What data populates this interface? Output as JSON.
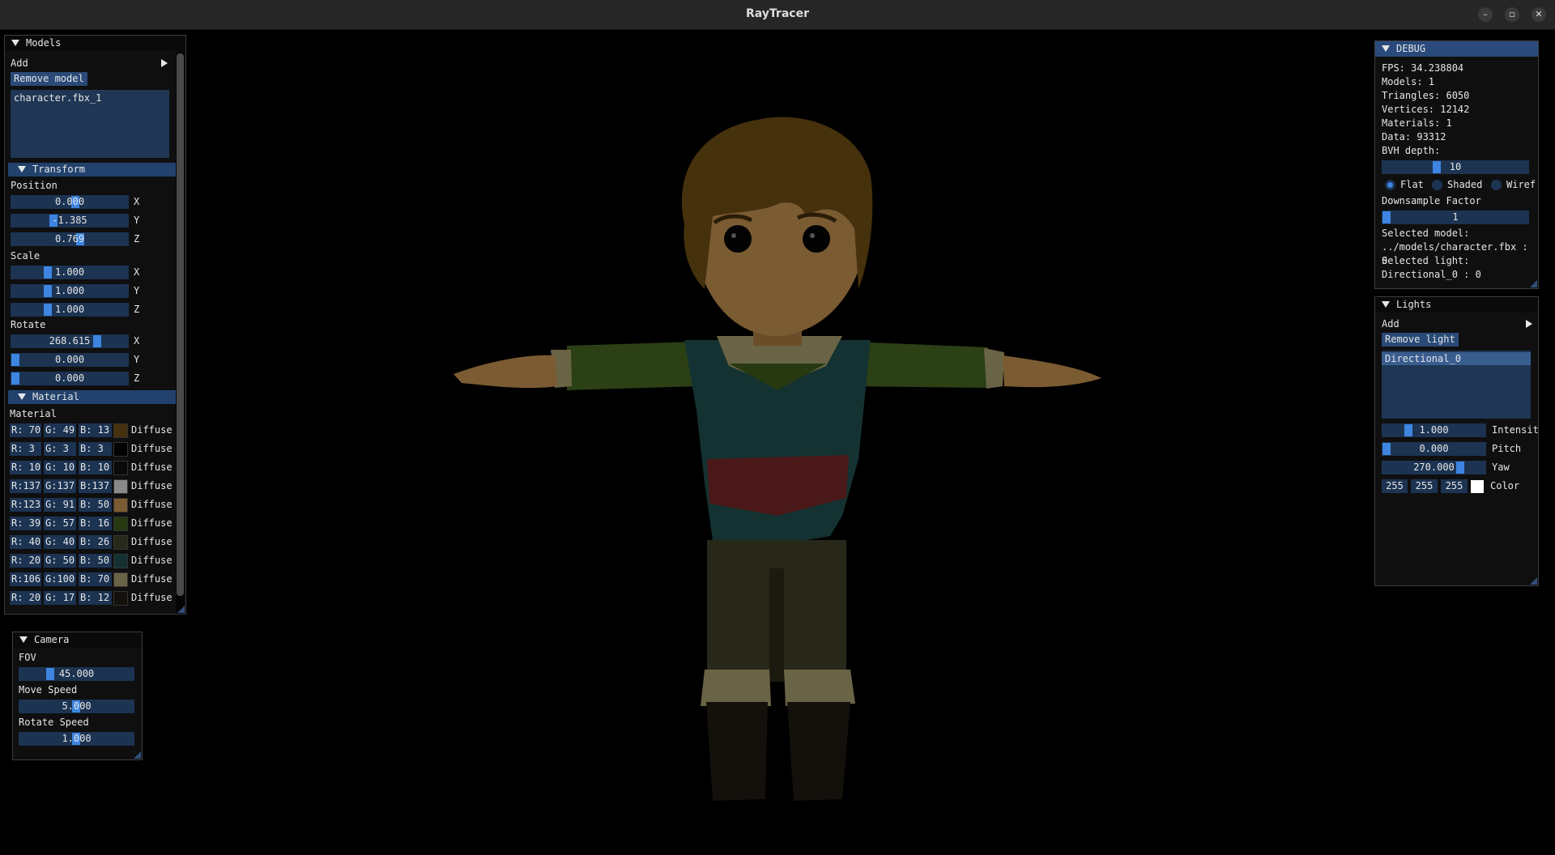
{
  "app": {
    "title": "RayTracer"
  },
  "window_controls": {
    "minimize": "–",
    "maximize": "▫",
    "close": "✕"
  },
  "models": {
    "title": "Models",
    "add_label": "Add",
    "remove_label": "Remove model",
    "items": [
      "character.fbx_1"
    ],
    "transform": {
      "title": "Transform",
      "position_label": "Position",
      "position": [
        {
          "value": "0.000",
          "axis": "X",
          "level": 0.55
        },
        {
          "value": "-1.385",
          "axis": "Y",
          "level": 0.35
        },
        {
          "value": "0.769",
          "axis": "Z",
          "level": 0.6
        }
      ],
      "scale_label": "Scale",
      "scale": [
        {
          "value": "1.000",
          "axis": "X",
          "level": 0.3
        },
        {
          "value": "1.000",
          "axis": "Y",
          "level": 0.3
        },
        {
          "value": "1.000",
          "axis": "Z",
          "level": 0.3
        }
      ],
      "rotate_label": "Rotate",
      "rotate": [
        {
          "value": "268.615",
          "axis": "X",
          "level": 0.75
        },
        {
          "value": "0.000",
          "axis": "Y",
          "level": 0.0
        },
        {
          "value": "0.000",
          "axis": "Z",
          "level": 0.0
        }
      ]
    },
    "material": {
      "title": "Material",
      "label": "Material",
      "rows": [
        {
          "r": "R: 70",
          "g": "G: 49",
          "b": "B: 13",
          "color": "#46310d",
          "type": "Diffuse"
        },
        {
          "r": "R:  3",
          "g": "G:  3",
          "b": "B:  3",
          "color": "#030303",
          "type": "Diffuse"
        },
        {
          "r": "R: 10",
          "g": "G: 10",
          "b": "B: 10",
          "color": "#0a0a0a",
          "type": "Diffuse"
        },
        {
          "r": "R:137",
          "g": "G:137",
          "b": "B:137",
          "color": "#898989",
          "type": "Diffuse"
        },
        {
          "r": "R:123",
          "g": "G: 91",
          "b": "B: 50",
          "color": "#7b5b32",
          "type": "Diffuse"
        },
        {
          "r": "R: 39",
          "g": "G: 57",
          "b": "B: 16",
          "color": "#273910",
          "type": "Diffuse"
        },
        {
          "r": "R: 40",
          "g": "G: 40",
          "b": "B: 26",
          "color": "#28281a",
          "type": "Diffuse"
        },
        {
          "r": "R: 20",
          "g": "G: 50",
          "b": "B: 50",
          "color": "#143232",
          "type": "Diffuse"
        },
        {
          "r": "R:106",
          "g": "G:100",
          "b": "B: 70",
          "color": "#6a6446",
          "type": "Diffuse"
        },
        {
          "r": "R: 20",
          "g": "G: 17",
          "b": "B: 12",
          "color": "#14110c",
          "type": "Diffuse"
        }
      ]
    }
  },
  "camera": {
    "title": "Camera",
    "fov_label": "FOV",
    "fov": "45.000",
    "fov_level": 0.25,
    "move_label": "Move Speed",
    "move": "5.000",
    "move_level": 0.5,
    "rotate_label": "Rotate Speed",
    "rotate": "1.000",
    "rotate_level": 0.5
  },
  "debug": {
    "title": "DEBUG",
    "fps": "FPS: 34.238804",
    "models": "Models: 1",
    "triangles": "Triangles: 6050",
    "vertices": "Vertices: 12142",
    "materials": "Materials: 1",
    "data": "Data: 93312",
    "bvh_label": "BVH depth:",
    "bvh_value": "10",
    "bvh_level": 0.35,
    "shading_modes": [
      "Flat",
      "Shaded",
      "Wiref"
    ],
    "shading_selected": "Flat",
    "downsample_label": "Downsample Factor",
    "downsample_value": "1",
    "downsample_level": 0.0,
    "selected_model_label": "Selected model:",
    "selected_model": "../models/character.fbx : 0",
    "selected_light_label": "Selected light:",
    "selected_light": "Directional_0 : 0"
  },
  "lights": {
    "title": "Lights",
    "add_label": "Add",
    "remove_label": "Remove light",
    "items": [
      "Directional_0"
    ],
    "intensity": "1.000",
    "intensity_label": "Intensit",
    "intensity_level": 0.2,
    "pitch": "0.000",
    "pitch_label": "Pitch",
    "pitch_level": 0.0,
    "yaw": "270.000",
    "yaw_label": "Yaw",
    "yaw_level": 0.75,
    "color_r": "255",
    "color_g": "255",
    "color_b": "255",
    "color_label": "Color",
    "color_swatch": "#ffffff"
  }
}
